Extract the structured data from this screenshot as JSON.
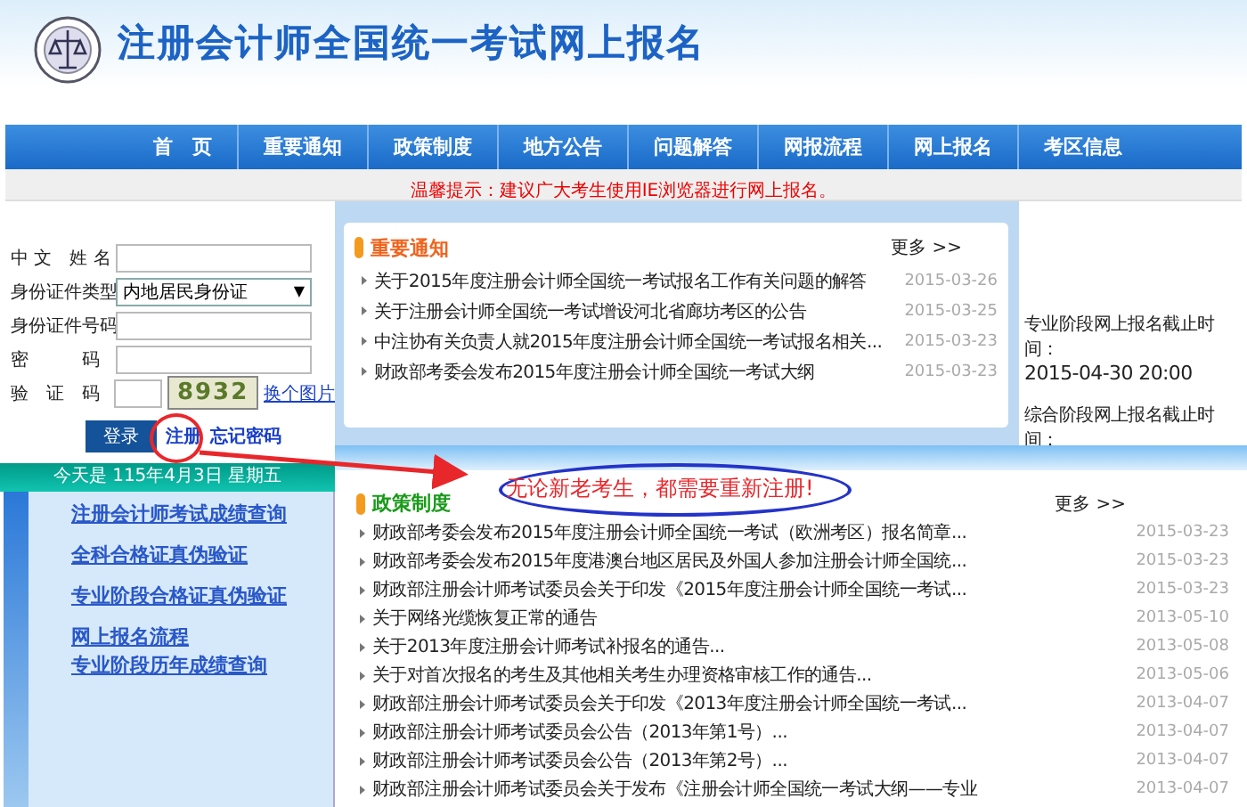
{
  "header": {
    "title": "注册会计师全国统一考试网上报名"
  },
  "nav": [
    {
      "label": "首　页"
    },
    {
      "label": "重要通知"
    },
    {
      "label": "政策制度"
    },
    {
      "label": "地方公告"
    },
    {
      "label": "问题解答"
    },
    {
      "label": "网报流程"
    },
    {
      "label": "网上报名"
    },
    {
      "label": "考区信息"
    }
  ],
  "notice": "温馨提示：建议广大考生使用IE浏览器进行网上报名。",
  "login": {
    "fields": [
      {
        "kind": "text",
        "label": "中 文　姓 名"
      },
      {
        "kind": "select",
        "label": "身份证件类型",
        "value": "内地居民身份证",
        "caret": "▼"
      },
      {
        "kind": "text",
        "label": "身份证件号码"
      },
      {
        "kind": "password",
        "label": "密　　　码"
      },
      {
        "kind": "captcha",
        "label": "验　证　码",
        "captcha": "8932",
        "link": "换个图片"
      }
    ],
    "buttons": [
      {
        "kind": "button",
        "label": "登录"
      },
      {
        "kind": "link",
        "label": "注册"
      },
      {
        "kind": "link",
        "label": "忘记密码"
      }
    ]
  },
  "date_bar": "今天是 115年4月3日 星期五",
  "quick_links": [
    "注册会计师考试成绩查询",
    "全科合格证真伪验证",
    "专业阶段合格证真伪验证",
    "网上报名流程",
    "专业阶段历年成绩查询"
  ],
  "important": {
    "title": "重要通知",
    "more": "更多 >>",
    "items": [
      {
        "title": "关于2015年度注册会计师全国统一考试报名工作有关问题的解答",
        "date": "2015-03-26"
      },
      {
        "title": "关于注册会计师全国统一考试增设河北省廊坊考区的公告",
        "date": "2015-03-25"
      },
      {
        "title": "中注协有关负责人就2015年度注册会计师全国统一考试报名相关...",
        "date": "2015-03-23"
      },
      {
        "title": "财政部考委会发布2015年度注册会计师全国统一考试大纲",
        "date": "2015-03-23"
      }
    ]
  },
  "deadlines": [
    {
      "label": "专业阶段网上报名截止时间：",
      "value": "2015-04-30 20:00"
    },
    {
      "label": "综合阶段网上报名截止时间："
    }
  ],
  "policy": {
    "title": "政策制度",
    "more": "更多 >>",
    "items": [
      {
        "title": "财政部考委会发布2015年度注册会计师全国统一考试（欧洲考区）报名简章...",
        "date": "2015-03-23"
      },
      {
        "title": "财政部考委会发布2015年度港澳台地区居民及外国人参加注册会计师全国统...",
        "date": "2015-03-23"
      },
      {
        "title": "财政部注册会计师考试委员会关于印发《2015年度注册会计师全国统一考试...",
        "date": "2015-03-23"
      },
      {
        "title": "关于网络光缆恢复正常的通告",
        "date": "2013-05-10"
      },
      {
        "title": "关于2013年度注册会计师考试补报名的通告...",
        "date": "2013-05-08"
      },
      {
        "title": "关于对首次报名的考生及其他相关考生办理资格审核工作的通告...",
        "date": "2013-05-06"
      },
      {
        "title": "财政部注册会计师考试委员会关于印发《2013年度注册会计师全国统一考试...",
        "date": "2013-04-07"
      },
      {
        "title": "财政部注册会计师考试委员会公告（2013年第1号）...",
        "date": "2013-04-07"
      },
      {
        "title": "财政部注册会计师考试委员会公告（2013年第2号）...",
        "date": "2013-04-07"
      },
      {
        "title": "财政部注册会计师考试委员会关于发布《注册会计师全国统一考试大纲——专业",
        "date": "2013-04-07"
      }
    ]
  },
  "annotation": {
    "text": "无论新老考生，都需要重新注册!"
  }
}
